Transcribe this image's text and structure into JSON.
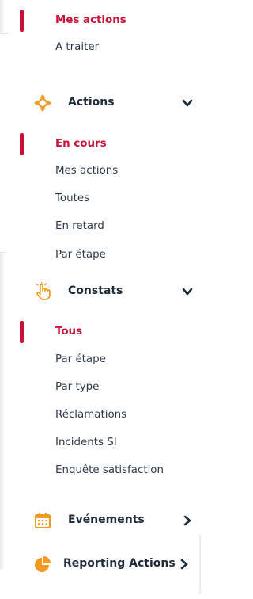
{
  "top_group": {
    "items": [
      {
        "label": "Mes actions",
        "active": true
      },
      {
        "label": "A traiter",
        "active": false
      }
    ]
  },
  "actions_section": {
    "title": "Actions",
    "icon": "move-arrows-icon",
    "icon_color": "#f29a1f",
    "expanded": true,
    "items": [
      {
        "label": "En cours",
        "active": true
      },
      {
        "label": "Mes actions",
        "active": false
      },
      {
        "label": "Toutes",
        "active": false
      },
      {
        "label": "En retard",
        "active": false
      },
      {
        "label": "Par étape",
        "active": false
      }
    ]
  },
  "constats_section": {
    "title": "Constats",
    "icon": "pointer-hand-icon",
    "icon_color": "#f29a1f",
    "expanded": true,
    "items": [
      {
        "label": "Tous",
        "active": true
      },
      {
        "label": "Par étape",
        "active": false
      },
      {
        "label": "Par type",
        "active": false
      },
      {
        "label": "Réclamations",
        "active": false
      },
      {
        "label": "Incidents SI",
        "active": false
      },
      {
        "label": "Enquête satisfaction",
        "active": false
      }
    ]
  },
  "evenements_section": {
    "title": "Evénements",
    "icon": "calendar-icon",
    "icon_color": "#f29a1f",
    "expanded": false
  },
  "reporting_section": {
    "title": "Reporting Actions",
    "icon": "pie-chart-icon",
    "icon_color": "#f29a1f",
    "expanded": false
  },
  "colors": {
    "accent": "#c8123a",
    "icon": "#f29a1f",
    "text": "#2c3a4a"
  }
}
